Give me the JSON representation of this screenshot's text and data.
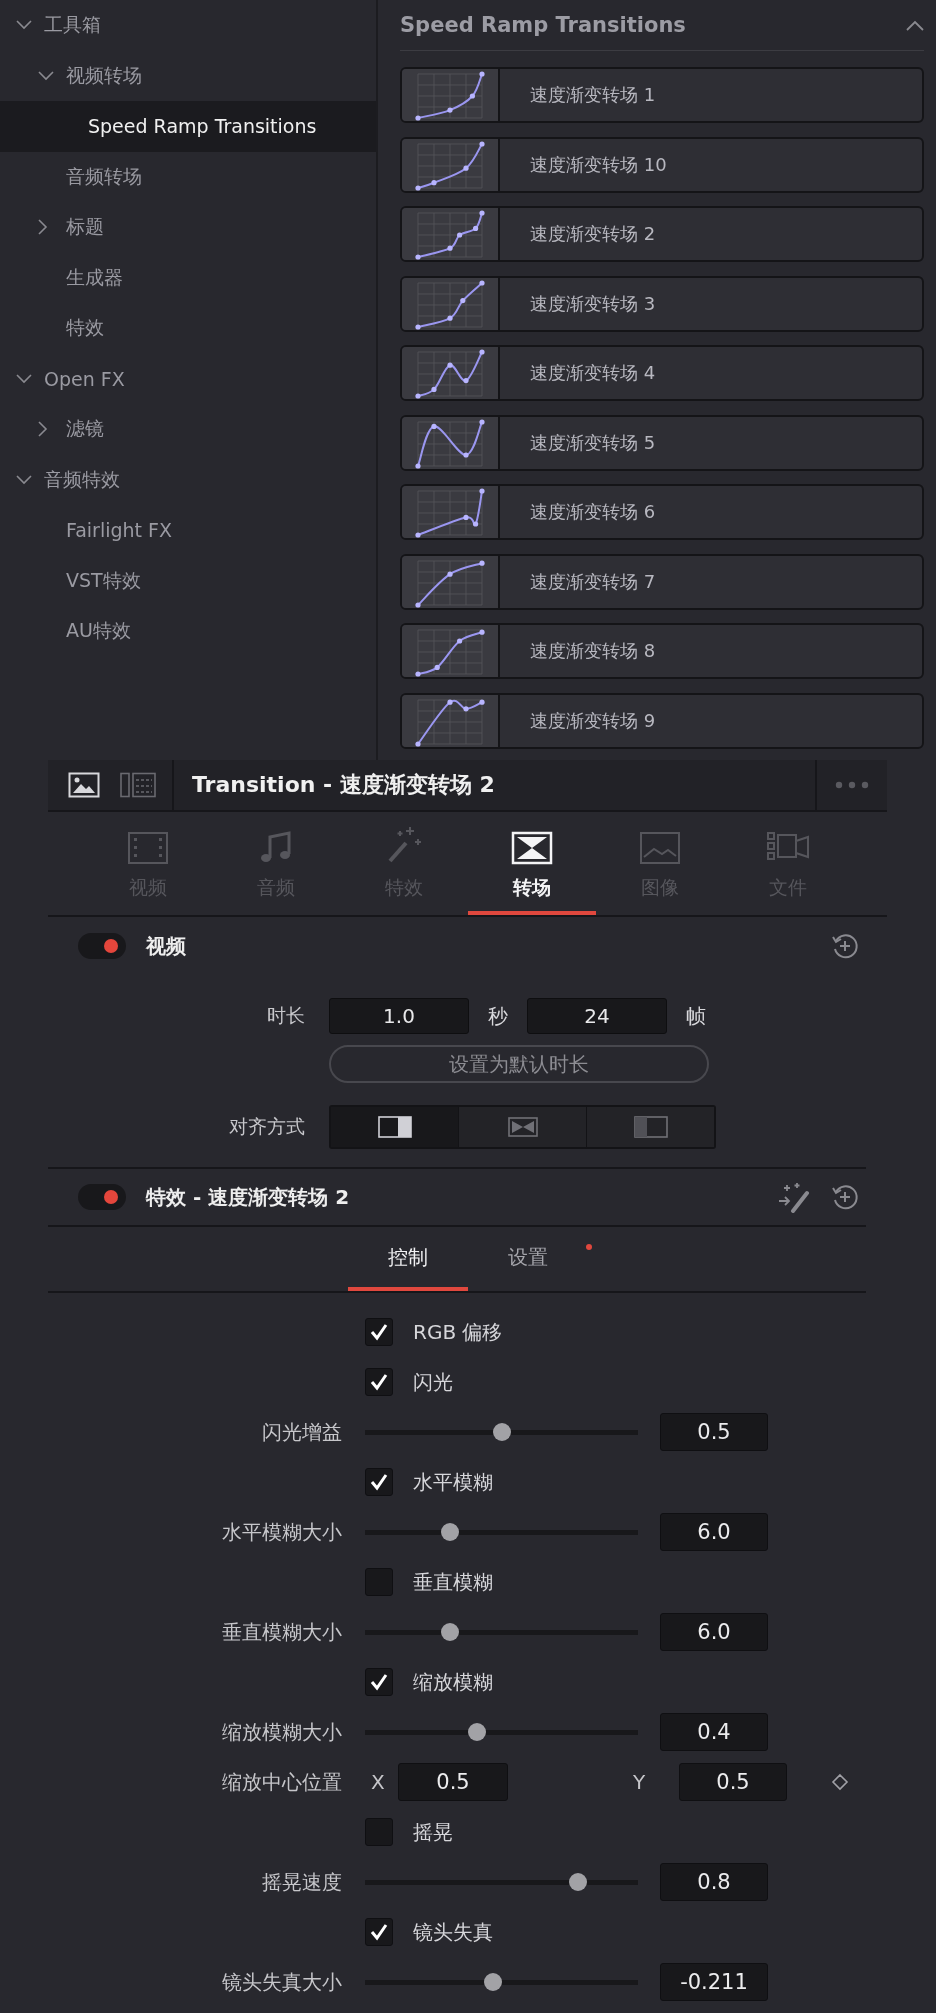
{
  "toolbox_tree": [
    {
      "label": "工具箱",
      "expanded": true,
      "selected": false,
      "children": [
        {
          "label": "视频转场",
          "expanded": true,
          "selected": false,
          "children": [
            {
              "label": "Speed Ramp Transitions",
              "selected": true
            }
          ]
        },
        {
          "label": "音频转场",
          "selected": false
        },
        {
          "label": "标题",
          "expanded": false,
          "selected": false
        },
        {
          "label": "生成器",
          "selected": false
        },
        {
          "label": "特效",
          "selected": false
        }
      ]
    },
    {
      "label": "Open FX",
      "expanded": true,
      "selected": false,
      "children": [
        {
          "label": "滤镜",
          "expanded": false,
          "selected": false
        }
      ]
    },
    {
      "label": "音频特效",
      "expanded": true,
      "selected": false,
      "children": [
        {
          "label": "Fairlight FX",
          "selected": false
        },
        {
          "label": "VST特效",
          "selected": false
        },
        {
          "label": "AU特效",
          "selected": false
        }
      ]
    }
  ],
  "effects_library": {
    "title": "Speed Ramp Transitions",
    "items": [
      {
        "label": "速度渐变转场 1"
      },
      {
        "label": "速度渐变转场 10"
      },
      {
        "label": "速度渐变转场 2"
      },
      {
        "label": "速度渐变转场 3"
      },
      {
        "label": "速度渐变转场 4"
      },
      {
        "label": "速度渐变转场 5"
      },
      {
        "label": "速度渐变转场 6"
      },
      {
        "label": "速度渐变转场 7"
      },
      {
        "label": "速度渐变转场 8"
      },
      {
        "label": "速度渐变转场 9"
      }
    ]
  },
  "inspector": {
    "title": "Transition - 速度渐变转场 2",
    "tabs": [
      {
        "kind": "video",
        "label": "视频",
        "selected": false,
        "disabled": true
      },
      {
        "kind": "audio",
        "label": "音频",
        "selected": false,
        "disabled": true
      },
      {
        "kind": "effects",
        "label": "特效",
        "selected": false,
        "disabled": true
      },
      {
        "kind": "transition",
        "label": "转场",
        "selected": true,
        "disabled": false
      },
      {
        "kind": "image",
        "label": "图像",
        "selected": false,
        "disabled": true
      },
      {
        "kind": "file",
        "label": "文件",
        "selected": false,
        "disabled": true
      }
    ],
    "video_section": {
      "title": "视频",
      "on": true,
      "duration_label": "时长",
      "seconds_value": "1.0",
      "seconds_unit": "秒",
      "frames_value": "24",
      "frames_unit": "帧",
      "default_button": "设置为默认时长",
      "alignment_label": "对齐方式",
      "alignment_options": [
        {
          "kind": "end",
          "selected": true
        },
        {
          "kind": "center",
          "selected": false
        },
        {
          "kind": "start",
          "selected": false
        }
      ]
    },
    "effect_section": {
      "title": "特效 - 速度渐变转场 2",
      "on": true,
      "tabs": [
        {
          "label": "控制",
          "selected": true,
          "modified": false
        },
        {
          "label": "设置",
          "selected": false,
          "modified": true
        }
      ],
      "controls": [
        {
          "kind": "checkbox",
          "label": "RGB 偏移",
          "checked": true
        },
        {
          "kind": "checkbox",
          "label": "闪光",
          "checked": true
        },
        {
          "kind": "slider",
          "label": "闪光增益",
          "level": 0.5,
          "value": "0.5"
        },
        {
          "kind": "checkbox",
          "label": "水平模糊",
          "checked": true
        },
        {
          "kind": "slider",
          "label": "水平模糊大小",
          "level": 0.31,
          "value": "6.0"
        },
        {
          "kind": "checkbox",
          "label": "垂直模糊",
          "checked": false
        },
        {
          "kind": "slider",
          "label": "垂直模糊大小",
          "level": 0.31,
          "value": "6.0"
        },
        {
          "kind": "checkbox",
          "label": "缩放模糊",
          "checked": true
        },
        {
          "kind": "slider",
          "label": "缩放模糊大小",
          "level": 0.41,
          "value": "0.4"
        },
        {
          "kind": "xy",
          "label": "缩放中心位置",
          "x_label": "X",
          "x_value": "0.5",
          "y_label": "Y",
          "y_value": "0.5"
        },
        {
          "kind": "checkbox",
          "label": "摇晃",
          "checked": false
        },
        {
          "kind": "slider",
          "label": "摇晃速度",
          "level": 0.78,
          "value": "0.8"
        },
        {
          "kind": "checkbox",
          "label": "镜头失真",
          "checked": true
        },
        {
          "kind": "slider",
          "label": "镜头失真大小",
          "level": 0.47,
          "value": "-0.211"
        }
      ]
    }
  }
}
